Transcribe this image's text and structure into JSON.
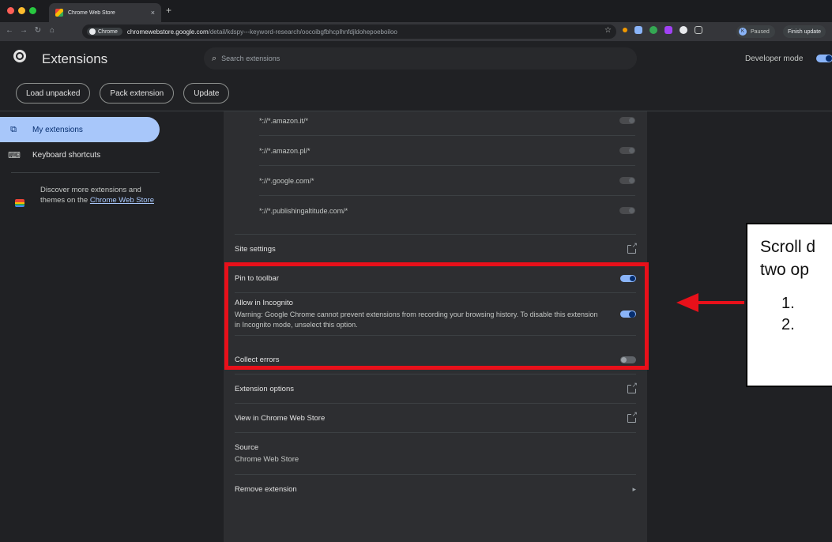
{
  "browser": {
    "tab_title": "Chrome Web Store",
    "tab_close": "×",
    "new_tab": "+",
    "chip_label": "Chrome",
    "url_host": "chromewebstore.google.com",
    "url_path": "/detail/kdspy---keyword-research/oocoibgfbhcplhnfdjldohepoeboiloo",
    "profile_initial": "K",
    "profile_status": "Paused",
    "finish_update": "Finish update"
  },
  "header": {
    "title": "Extensions",
    "search_placeholder": "Search extensions",
    "developer_mode_label": "Developer mode",
    "developer_mode_on": true,
    "buttons": [
      "Load unpacked",
      "Pack extension",
      "Update"
    ]
  },
  "sidebar": {
    "items": [
      {
        "label": "My extensions",
        "icon": "puzzle-icon",
        "active": true
      },
      {
        "label": "Keyboard shortcuts",
        "icon": "keyboard-icon",
        "active": false
      }
    ],
    "discover_text": "Discover more extensions and themes on the ",
    "discover_link": "Chrome Web Store"
  },
  "site_access": {
    "hosts": [
      {
        "pattern": "*://*.amazon.it/*",
        "enabled": false
      },
      {
        "pattern": "*://*.amazon.pl/*",
        "enabled": false
      },
      {
        "pattern": "*://*.google.com/*",
        "enabled": false
      },
      {
        "pattern": "*://*.publishingaltitude.com/*",
        "enabled": false
      }
    ]
  },
  "details": {
    "site_settings": "Site settings",
    "pin_to_toolbar": "Pin to toolbar",
    "pin_enabled": true,
    "allow_incognito": "Allow in Incognito",
    "incognito_warning": "Warning: Google Chrome cannot prevent extensions from recording your browsing history. To disable this extension in Incognito mode, unselect this option.",
    "incognito_enabled": true,
    "collect_errors": "Collect errors",
    "collect_errors_enabled": false,
    "extension_options": "Extension options",
    "view_in_store": "View in Chrome Web Store",
    "source_label": "Source",
    "source_value": "Chrome Web Store",
    "remove_extension": "Remove extension"
  },
  "annotation": {
    "line1": "Scroll d",
    "line2": "two op",
    "item1": "1.",
    "item2": "2.",
    "highlight_color": "#e8101a"
  }
}
